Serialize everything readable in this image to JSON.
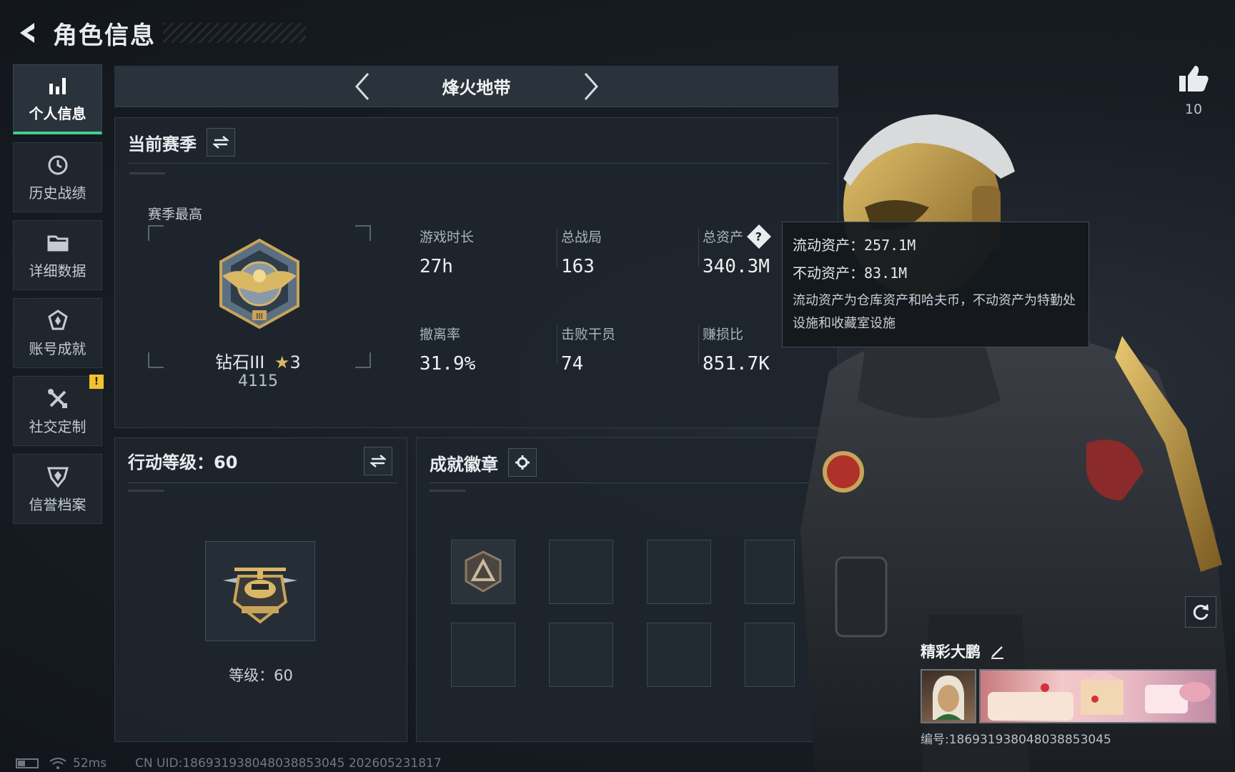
{
  "header": {
    "title": "角色信息"
  },
  "sidebar": {
    "items": [
      {
        "label": "个人信息",
        "icon": "bar-chart-icon",
        "active": true
      },
      {
        "label": "历史战绩",
        "icon": "history-icon"
      },
      {
        "label": "详细数据",
        "icon": "folder-icon"
      },
      {
        "label": "账号成就",
        "icon": "achievement-icon"
      },
      {
        "label": "社交定制",
        "icon": "tools-icon",
        "badge": "!"
      },
      {
        "label": "信誉档案",
        "icon": "credit-shield-icon"
      }
    ]
  },
  "mode": {
    "title": "烽火地带"
  },
  "season": {
    "title": "当前赛季",
    "best_label": "赛季最高",
    "rank_name": "钻石III",
    "rank_stars": "3",
    "rank_score": "4115",
    "stats": [
      {
        "label": "游戏时长",
        "value": "27h"
      },
      {
        "label": "总战局",
        "value": "163"
      },
      {
        "label": "总资产",
        "value": "340.3M"
      },
      {
        "label": "撤离率",
        "value": "31.9%"
      },
      {
        "label": "击败干员",
        "value": "74"
      },
      {
        "label": "赚损比",
        "value": "851.7K"
      }
    ]
  },
  "tooltip": {
    "liquid": "流动资产：257.1M",
    "fixed": "不动资产：83.1M",
    "note": "流动资产为仓库资产和哈夫币，不动资产为特勤处设施和收藏室设施"
  },
  "level_panel": {
    "title": "行动等级：60",
    "level_text": "等级：60"
  },
  "badges": {
    "title": "成就徽章"
  },
  "likes": {
    "count": "10"
  },
  "profile": {
    "name": "精彩大鹏",
    "id_text": "编号:186931938048038853045"
  },
  "footer": {
    "ping": "52ms",
    "uid": "CN UID:186931938048038853045 202605231817"
  },
  "colors": {
    "accent": "#3ecf8e",
    "warn": "#f2c12e",
    "panel": "#1e252d"
  }
}
